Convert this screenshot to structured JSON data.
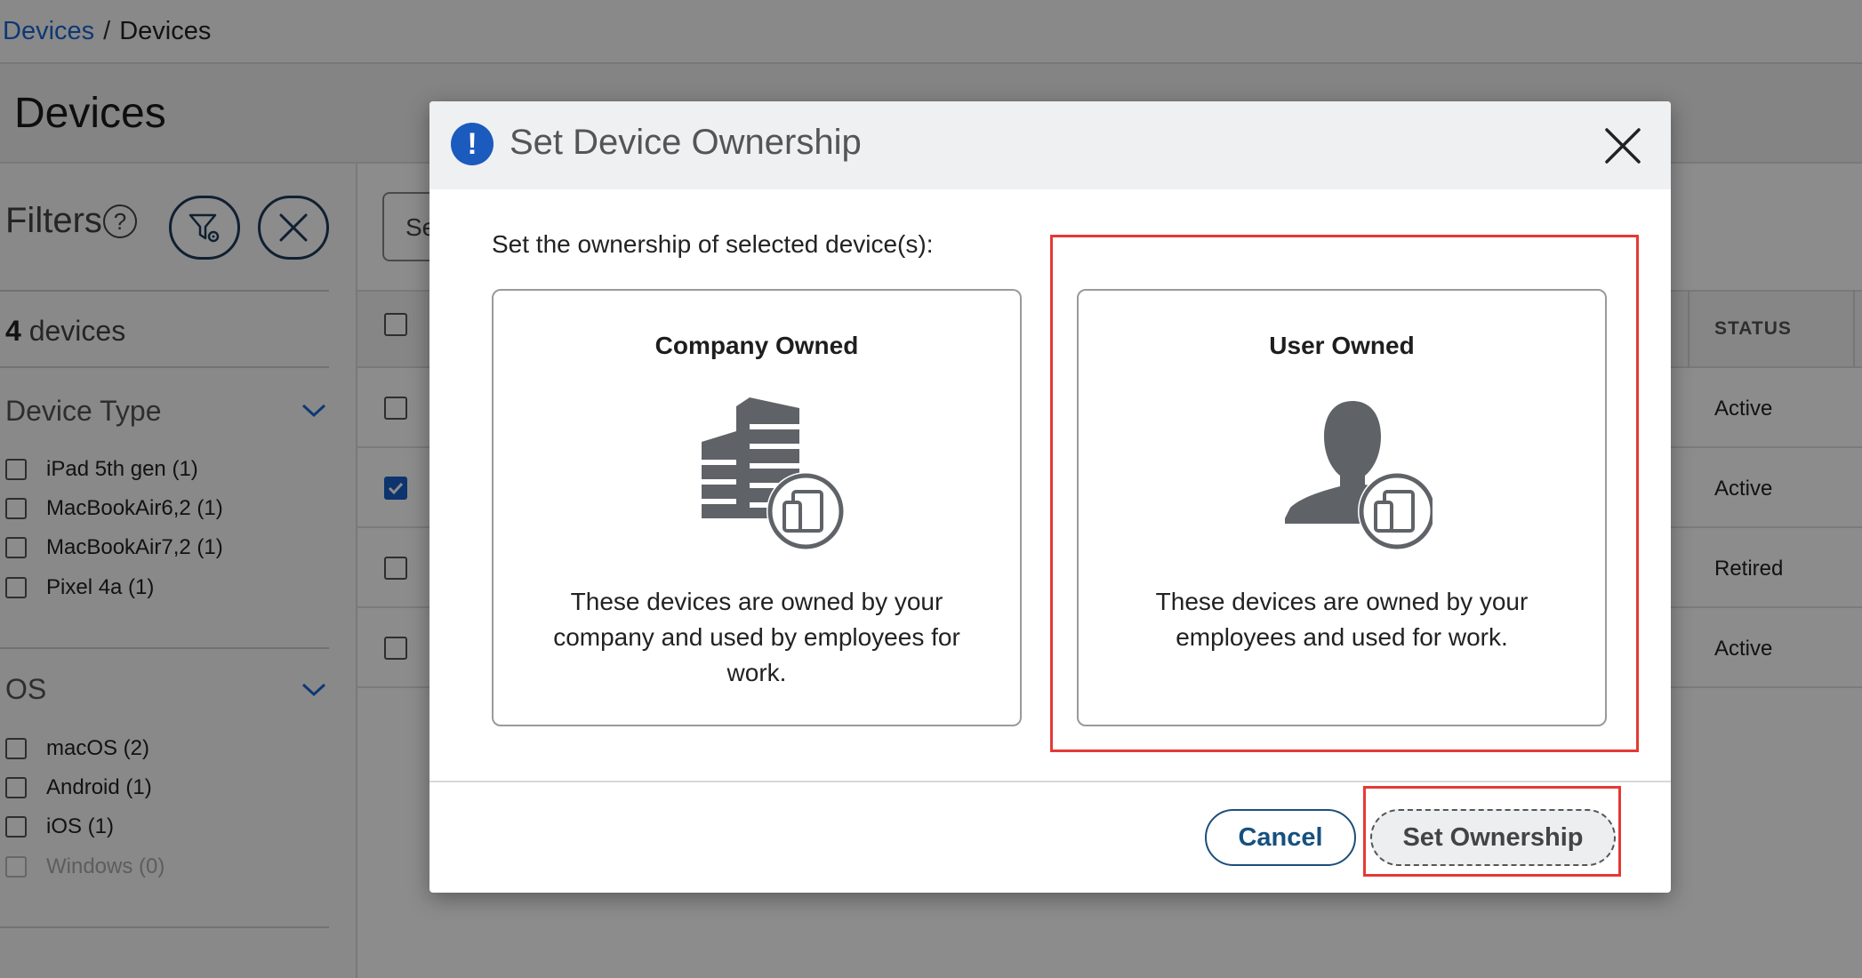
{
  "breadcrumb": {
    "link": "Devices",
    "separator": "/",
    "current": "Devices"
  },
  "page": {
    "title": "Devices"
  },
  "sidebar": {
    "filters_label": "Filters",
    "help_glyph": "?",
    "device_count": "4",
    "device_count_suffix": "devices",
    "device_type": {
      "title": "Device Type",
      "options": [
        "iPad 5th gen (1)",
        "MacBookAir6,2 (1)",
        "MacBookAir7,2 (1)",
        "Pixel 4a (1)"
      ]
    },
    "os": {
      "title": "OS",
      "options": [
        "macOS (2)",
        "Android (1)",
        "iOS (1)",
        "Windows (0)"
      ]
    }
  },
  "main": {
    "search_partial": "Se",
    "status_header": "STATUS",
    "rows": [
      {
        "checked": false,
        "status": "Active"
      },
      {
        "checked": true,
        "status": "Active"
      },
      {
        "checked": false,
        "status": "Retired"
      },
      {
        "checked": false,
        "status": "Active"
      }
    ]
  },
  "modal": {
    "title": "Set Device Ownership",
    "info_glyph": "!",
    "prompt": "Set the ownership of selected device(s):",
    "cards": [
      {
        "title": "Company Owned",
        "icon": "building-device-icon",
        "description": "These devices are owned by your company and used by employees for work."
      },
      {
        "title": "User Owned",
        "icon": "user-device-icon",
        "description": "These devices are owned by your employees and used for work."
      }
    ],
    "cancel_label": "Cancel",
    "submit_label": "Set Ownership"
  },
  "colors": {
    "accent_blue": "#1a5bbd",
    "link_blue": "#1a66d1",
    "button_navy": "#1d4e7a",
    "highlight_red": "#e53935",
    "icon_gray": "#5f6368"
  }
}
